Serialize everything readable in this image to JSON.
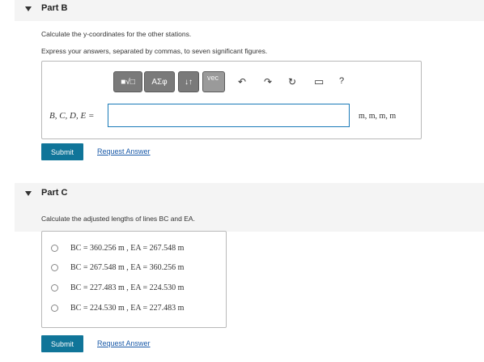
{
  "partB": {
    "title": "Part B",
    "instruction": "Calculate the y-coordinates for the other stations.",
    "format_note": "Express your answers, separated by commas, to seven significant figures.",
    "toolbar": {
      "btn_templates": "■√□",
      "btn_greek": "ΑΣφ",
      "btn_arrows": "↓↑",
      "btn_vec": "vec",
      "undo_icon": "↶",
      "redo_icon": "↷",
      "reset_icon": "↻",
      "keyboard_icon": "▭",
      "help_icon": "?"
    },
    "input_label": "B, C, D, E =",
    "input_value": "",
    "units": "m, m, m, m",
    "submit_label": "Submit",
    "request_answer_label": "Request Answer"
  },
  "partC": {
    "title": "Part C",
    "instruction": "Calculate the adjusted lengths of lines BC and EA.",
    "choices": [
      "BC = 360.256 m ,  EA = 267.548 m",
      "BC = 267.548 m ,  EA = 360.256 m",
      "BC = 227.483 m ,  EA = 224.530 m",
      "BC = 224.530 m ,  EA = 227.483 m"
    ],
    "submit_label": "Submit",
    "request_answer_label": "Request Answer"
  }
}
